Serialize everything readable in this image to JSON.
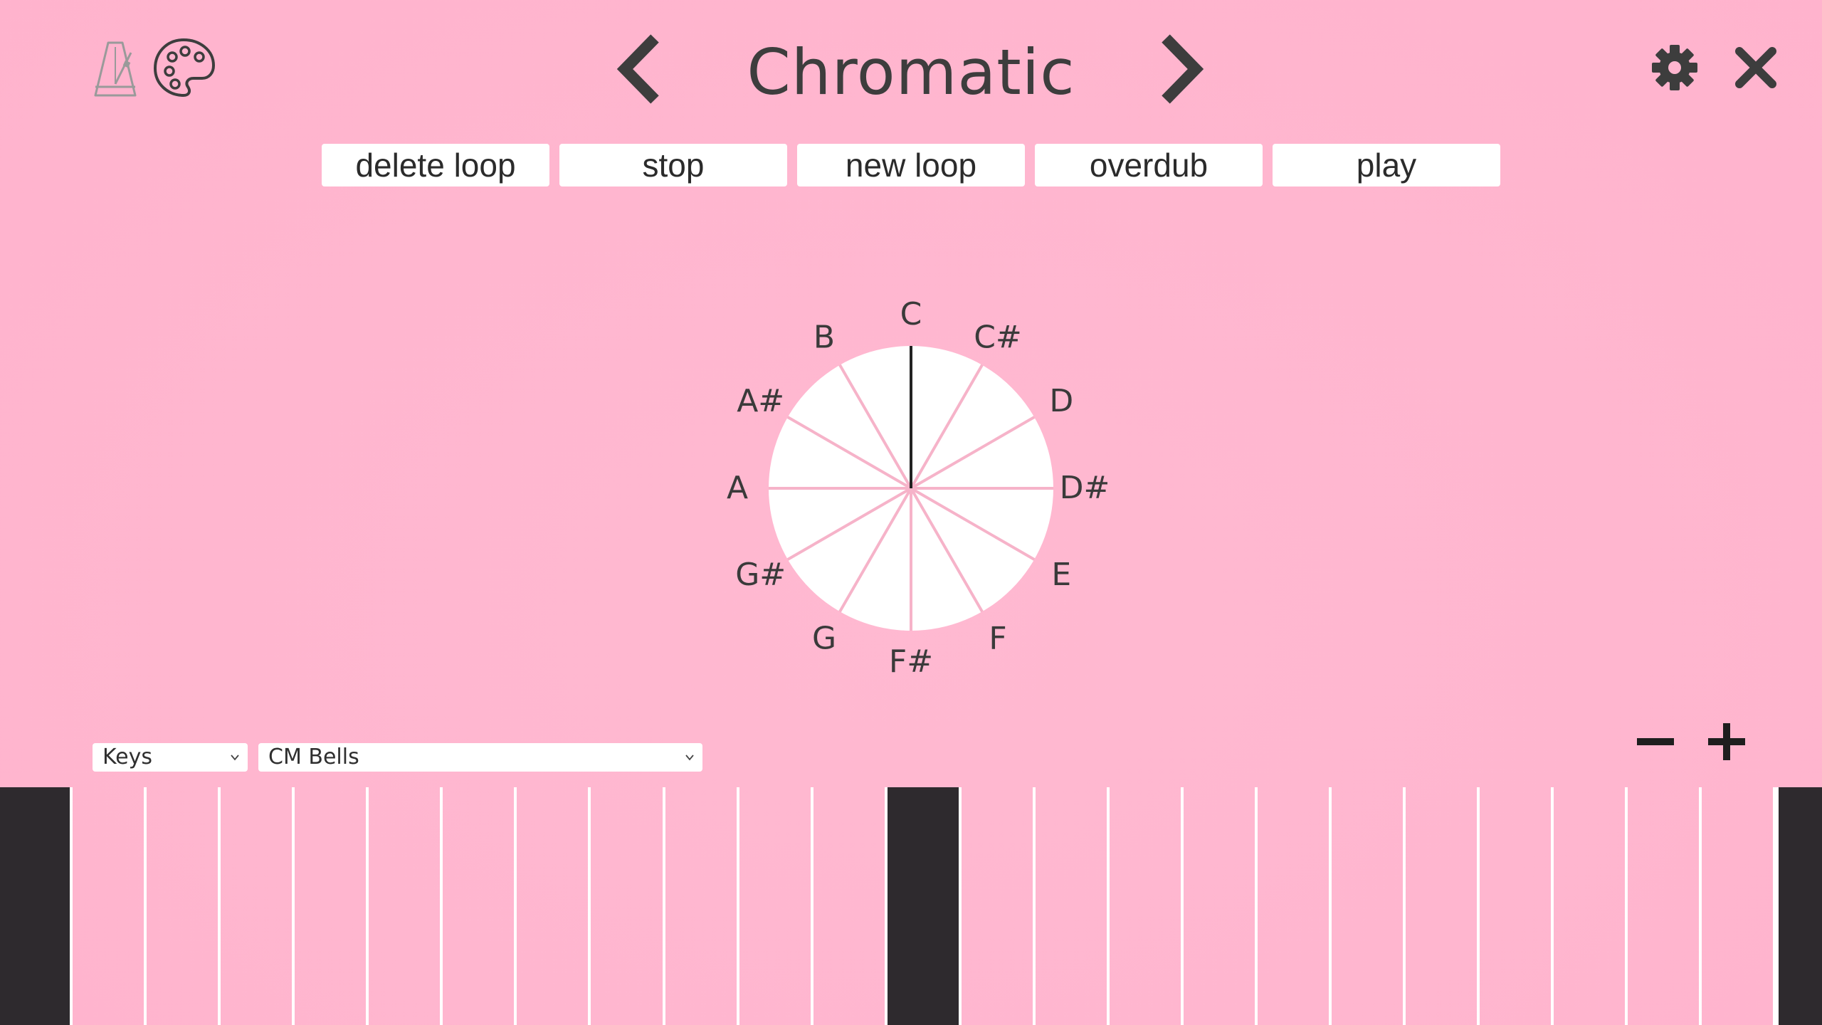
{
  "header": {
    "title": "Chromatic",
    "icons": {
      "metronome": "metronome-icon",
      "palette": "palette-icon",
      "prev": "chevron-left-icon",
      "next": "chevron-right-icon",
      "settings": "gear-icon",
      "close": "close-icon"
    }
  },
  "loop_controls": [
    {
      "label": "delete loop"
    },
    {
      "label": "stop"
    },
    {
      "label": "new loop"
    },
    {
      "label": "overdub"
    },
    {
      "label": "play"
    }
  ],
  "note_wheel": {
    "notes": [
      "C",
      "C#",
      "D",
      "D#",
      "E",
      "F",
      "F#",
      "G",
      "G#",
      "A",
      "A#",
      "B"
    ],
    "pointer_note": "C",
    "colors": {
      "fill": "#ffffff",
      "divider": "#f6b3c9",
      "pointer": "#222222"
    }
  },
  "bottom_controls": {
    "instrument_type": "Keys",
    "sound": "CM Bells",
    "zoom_out_icon": "minus-icon",
    "zoom_in_icon": "plus-icon"
  },
  "keyboard": {
    "highlighted_key_indices": [
      0,
      12,
      24
    ],
    "colors": {
      "background": "#ffb6cf",
      "highlight": "#2e2a2e",
      "separator": "#ffffff"
    }
  },
  "colors": {
    "accent_pink": "#ffb6cf",
    "icon_dark": "#3d3d3d",
    "button_bg": "#ffffff"
  }
}
